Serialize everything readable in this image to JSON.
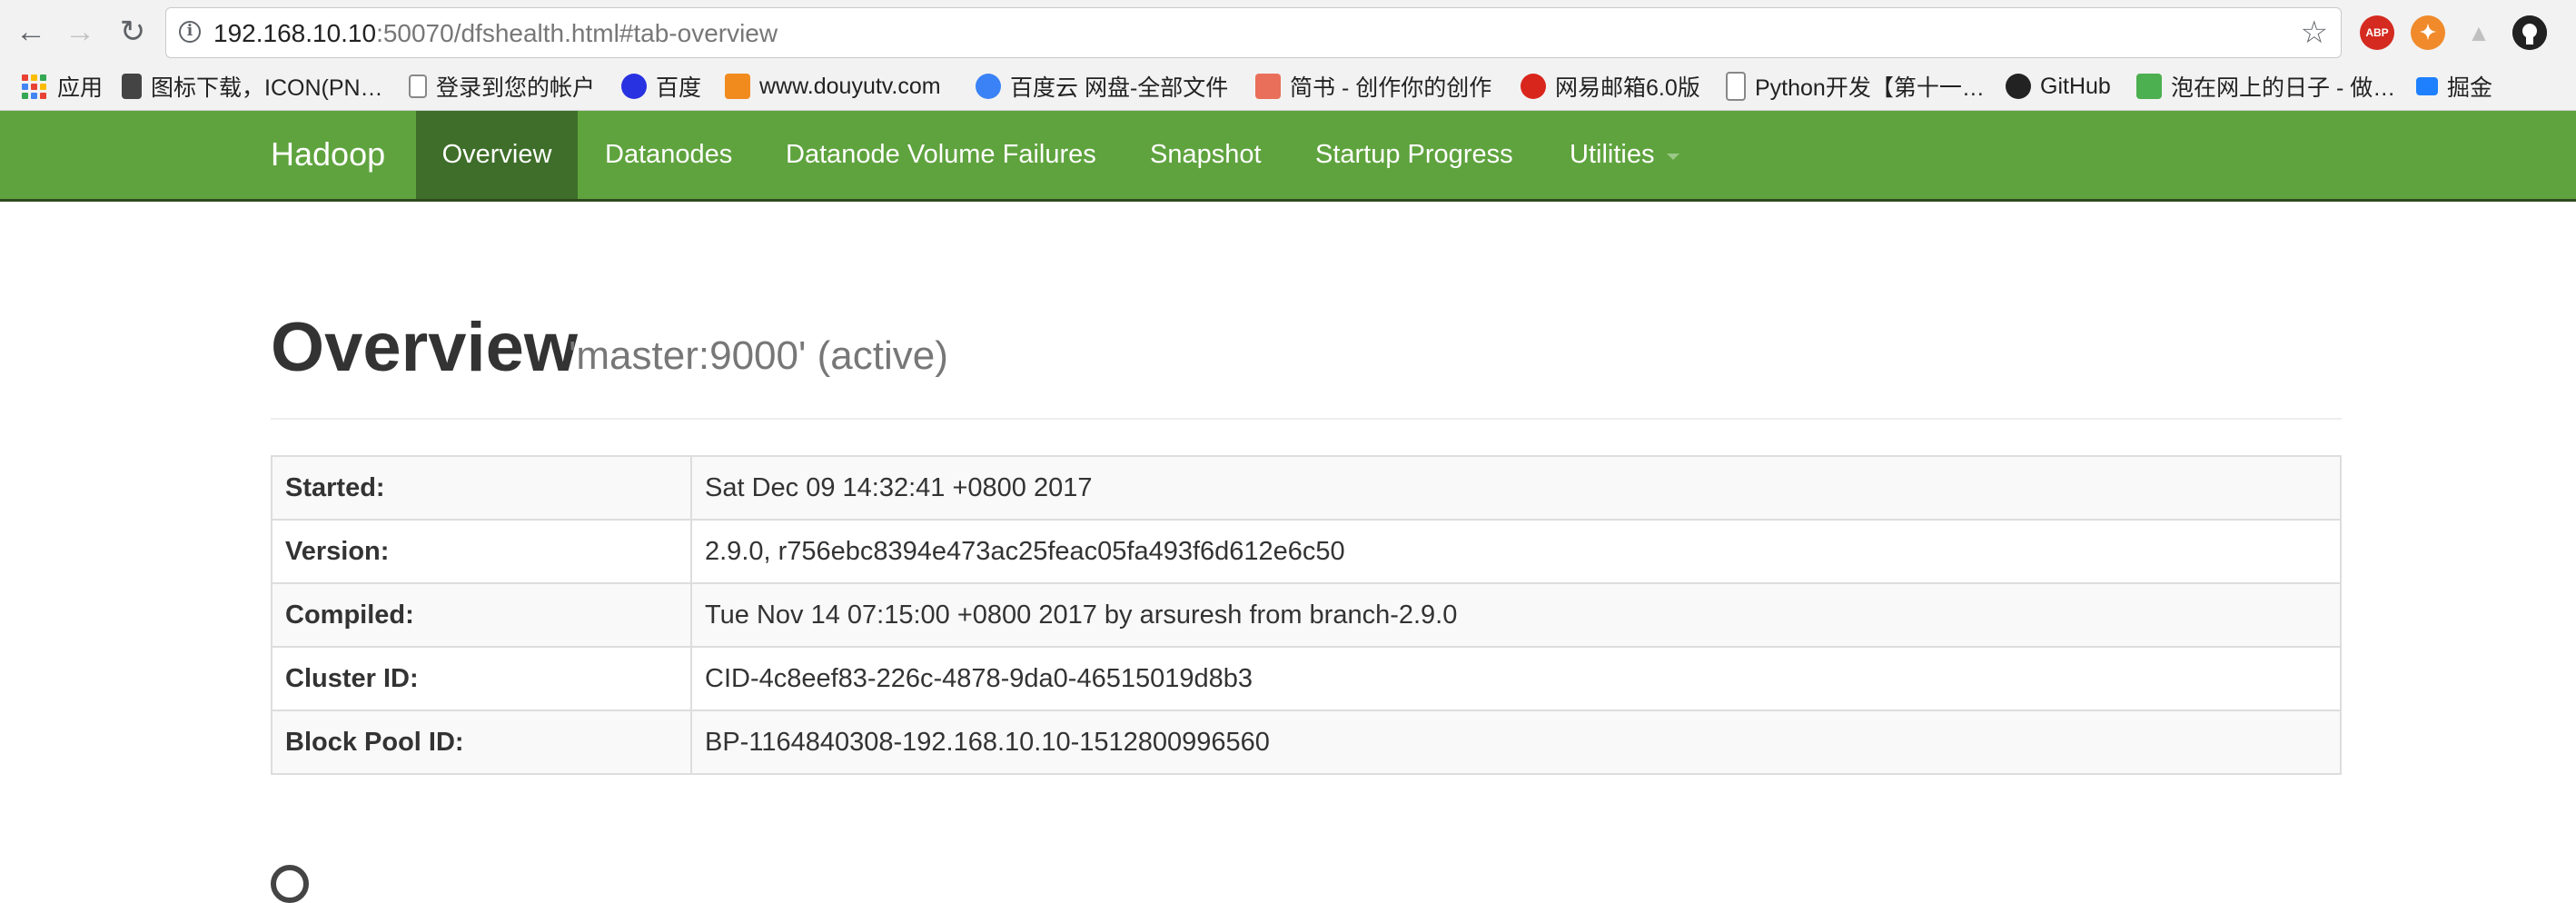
{
  "browser": {
    "url_host": "192.168.10.10",
    "url_rest": ":50070/dfshealth.html#tab-overview",
    "nav_back_icon": "arrow-left-icon",
    "nav_forward_icon": "arrow-right-icon",
    "reload_icon": "reload-icon",
    "info_icon": "info-icon",
    "star_icon": "star-icon",
    "extensions": {
      "abp_label": "ABP",
      "orange_icon": "orange-extension-icon",
      "tree_icon": "tree-extension-icon",
      "github_icon": "github-icon"
    }
  },
  "bookmarks": [
    {
      "label": "应用",
      "icon": "apps-grid-icon"
    },
    {
      "label": "图标下载，ICON(PN…",
      "icon": "bookmark-site-icon"
    },
    {
      "label": "登录到您的帐户",
      "icon": "page-icon"
    },
    {
      "label": "百度",
      "icon": "baidu-icon"
    },
    {
      "label": "www.douyutv.com",
      "icon": "douyu-icon"
    },
    {
      "label": "百度云 网盘-全部文件",
      "icon": "baidu-cloud-icon"
    },
    {
      "label": "简书 - 创作你的创作",
      "icon": "jianshu-icon"
    },
    {
      "label": "网易邮箱6.0版",
      "icon": "netease-mail-icon"
    },
    {
      "label": "Python开发【第十一…",
      "icon": "python-site-icon"
    },
    {
      "label": "GitHub",
      "icon": "github-icon"
    },
    {
      "label": "泡在网上的日子 - 做…",
      "icon": "jcodecraeer-icon"
    },
    {
      "label": "掘金",
      "icon": "juejin-icon"
    }
  ],
  "navbar": {
    "brand": "Hadoop",
    "items": [
      {
        "label": "Overview",
        "active": true
      },
      {
        "label": "Datanodes"
      },
      {
        "label": "Datanode Volume Failures"
      },
      {
        "label": "Snapshot"
      },
      {
        "label": "Startup Progress"
      },
      {
        "label": "Utilities",
        "dropdown": true
      }
    ],
    "color": "#5fa33e",
    "active_color": "#3e6e29"
  },
  "page": {
    "title": "Overview",
    "subtitle": "'master:9000' (active)",
    "info_rows": [
      {
        "key": "Started:",
        "value": "Sat Dec 09 14:32:41 +0800 2017"
      },
      {
        "key": "Version:",
        "value": "2.9.0, r756ebc8394e473ac25feac05fa493f6d612e6c50"
      },
      {
        "key": "Compiled:",
        "value": "Tue Nov 14 07:15:00 +0800 2017 by arsuresh from branch-2.9.0"
      },
      {
        "key": "Cluster ID:",
        "value": "CID-4c8eef83-226c-4878-9da0-46515019d8b3"
      },
      {
        "key": "Block Pool ID:",
        "value": "BP-1164840308-192.168.10.10-1512800996560"
      }
    ]
  }
}
